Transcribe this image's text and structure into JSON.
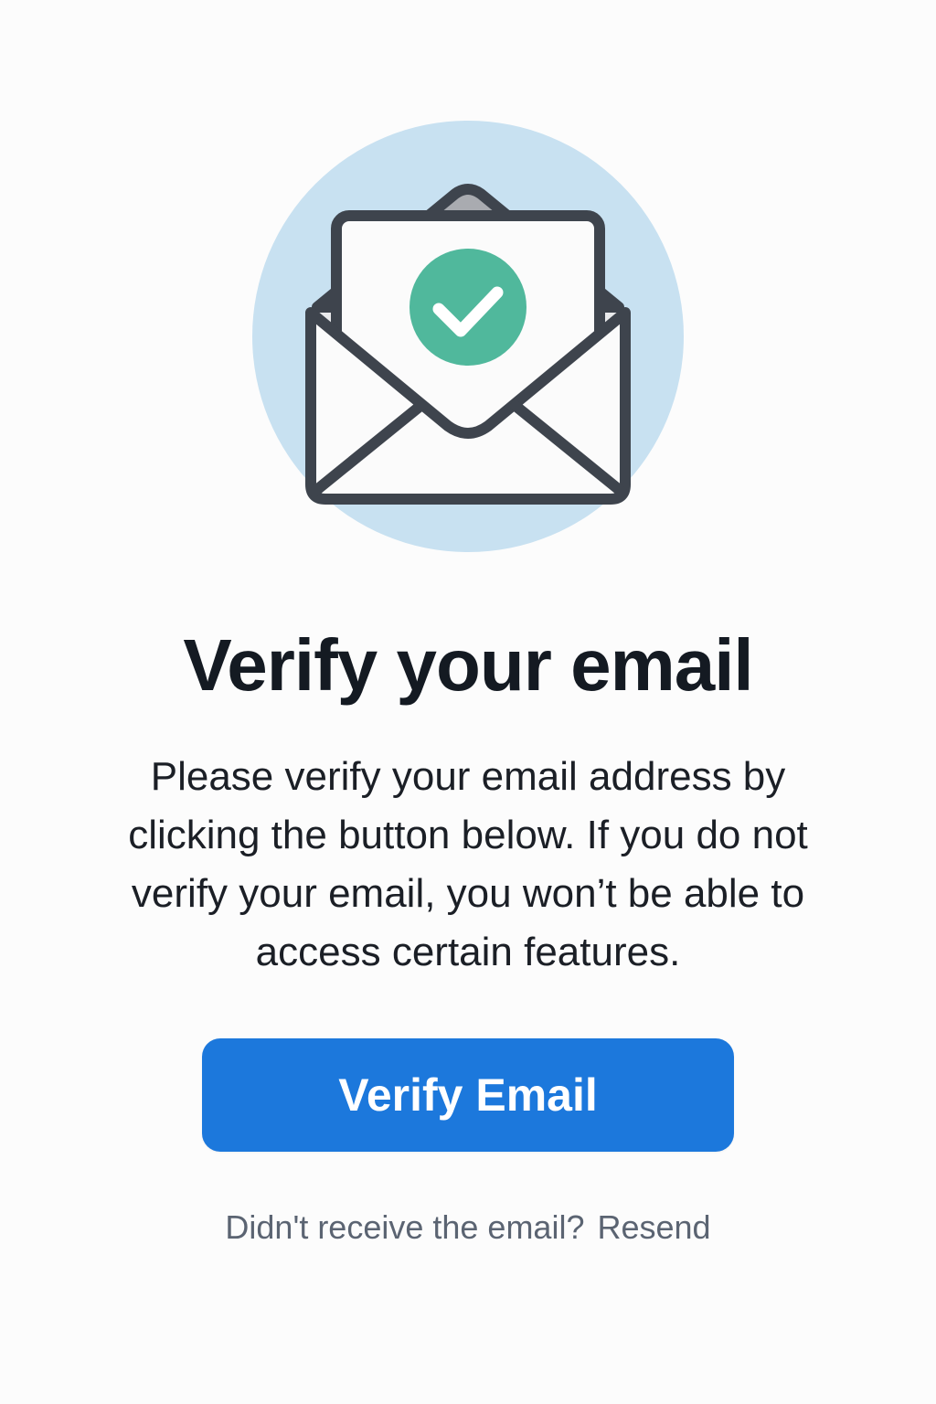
{
  "illustration": {
    "icon": "open-envelope-with-check-icon",
    "circle_color": "#c8e1f1",
    "check_color": "#50b89c",
    "outline_color": "#3e444d"
  },
  "title": "Verify your email",
  "description": "Please verify your email address by clicking the button below. If you do not verify your email, you won’t be able to access certain features.",
  "primary_button": {
    "label": "Verify Email",
    "color": "#1c78dc"
  },
  "resend": {
    "prompt": "Didn't receive the email?",
    "link_label": "Resend"
  }
}
